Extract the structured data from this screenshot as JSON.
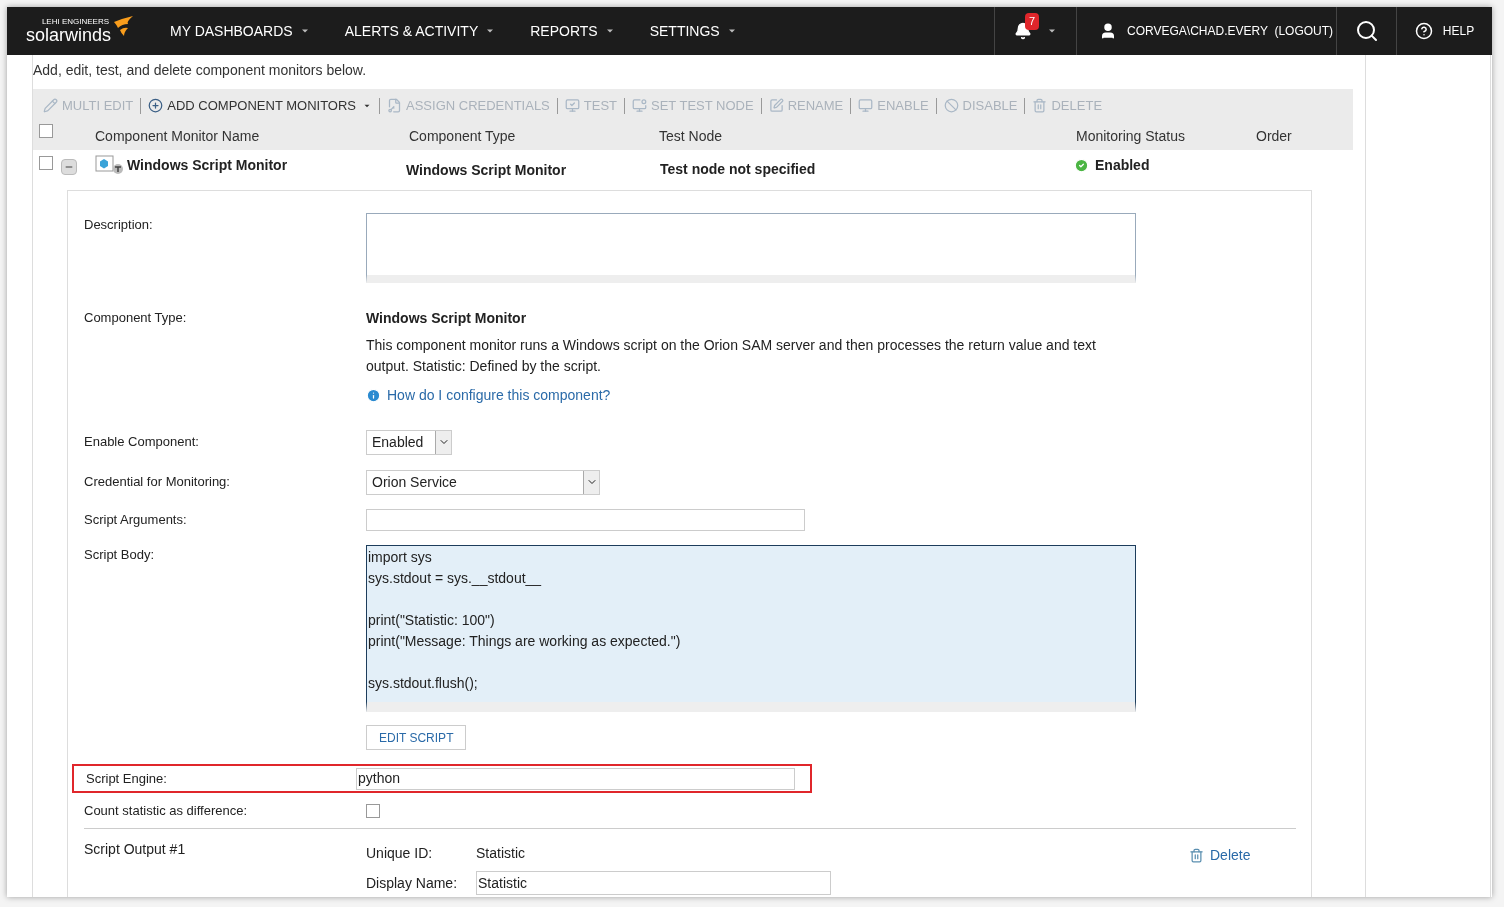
{
  "nav": {
    "logo_small": "LEHI ENGINEERS",
    "logo": "solarwinds",
    "menus": [
      {
        "label": "MY DASHBOARDS"
      },
      {
        "label": "ALERTS & ACTIVITY"
      },
      {
        "label": "REPORTS"
      },
      {
        "label": "SETTINGS"
      }
    ],
    "alert_count": "7",
    "user": "CORVEGA\\CHAD.EVERY  (LOGOUT)",
    "help": "HELP"
  },
  "intro": "Add, edit, test, and delete component monitors below.",
  "toolbar": [
    {
      "label": "MULTI EDIT",
      "disabled": true
    },
    {
      "label": "ADD COMPONENT MONITORS",
      "disabled": false,
      "dropdown": true
    },
    {
      "label": "ASSIGN CREDENTIALS",
      "disabled": true
    },
    {
      "label": "TEST",
      "disabled": true
    },
    {
      "label": "SET TEST NODE",
      "disabled": true
    },
    {
      "label": "RENAME",
      "disabled": true
    },
    {
      "label": "ENABLE",
      "disabled": true
    },
    {
      "label": "DISABLE",
      "disabled": true
    },
    {
      "label": "DELETE",
      "disabled": true
    }
  ],
  "columns": [
    "Component Monitor Name",
    "Component Type",
    "Test Node",
    "Monitoring Status",
    "Order"
  ],
  "header_checked": false,
  "row": {
    "checked": false,
    "expanded": true,
    "name": "Windows Script Monitor",
    "type": "Windows Script Monitor",
    "test_node": "Test node not specified",
    "status": "Enabled",
    "status_ok": true
  },
  "form": {
    "description_label": "Description:",
    "component_type_label": "Component Type:",
    "component_type": "Windows Script Monitor",
    "component_description": "This component monitor runs a Windows script on the Orion SAM server and then processes the return value and text output. Statistic: Defined by the script.",
    "help_link": "How do I configure this component?",
    "enable_label": "Enable Component:",
    "enable_value": "Enabled",
    "credential_label": "Credential for Monitoring:",
    "credential_value": "Orion Service",
    "arguments_label": "Script Arguments:",
    "body_label": "Script Body:",
    "body_blocks": [
      [
        "import sys",
        "sys.stdout = sys.__stdout__"
      ],
      [
        "print(\"Statistic: 100\")",
        "print(\"Message: Things are working as expected.\")"
      ],
      [
        "sys.stdout.flush();"
      ]
    ],
    "edit_script": "EDIT SCRIPT",
    "engine_label": "Script Engine:",
    "engine_value": "python",
    "engine_highlighted": true,
    "difference_label": "Count statistic as difference:",
    "difference_checked": false,
    "output_title": "Script Output #1",
    "unique_id_label": "Unique ID:",
    "unique_id": "Statistic",
    "display_name_label": "Display Name:",
    "display_name": "Statistic",
    "delete": "Delete"
  }
}
